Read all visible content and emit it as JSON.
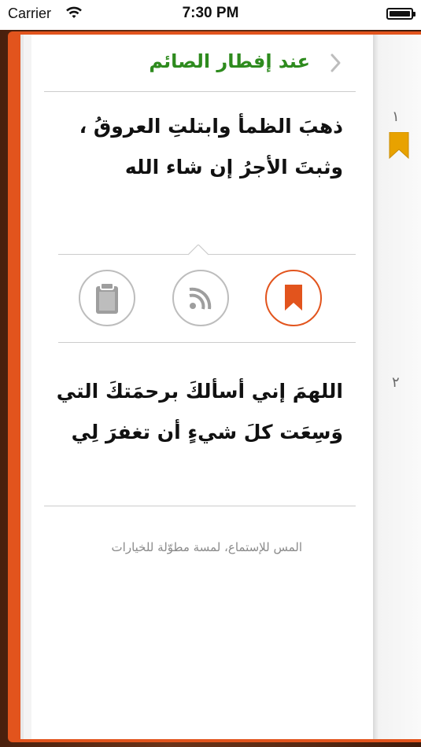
{
  "status_bar": {
    "carrier": "Carrier",
    "time": "7:30 PM"
  },
  "header": {
    "title": "عند إفطار الصائم"
  },
  "entries": [
    {
      "lines": [
        "ذهبَ الظمأ وابتلتِ العروقُ ،",
        "وثبتَ الأجرُ إن شاء الله"
      ]
    },
    {
      "lines": [
        "اللهمَ إني أسألكَ برحمَتكَ التي",
        "وَسِعَت كلَ شيءٍ أن تغفرَ لِي"
      ]
    }
  ],
  "toolbar": {
    "copy_icon": "clipboard-icon",
    "share_icon": "feed-icon",
    "bookmark_icon": "bookmark-icon",
    "active_color": "#e2541d"
  },
  "hint": "المس للإستماع، لمسة مطوّلة للخيارات",
  "side_numbers": [
    "١",
    "٢"
  ],
  "colors": {
    "accent": "#e2541d",
    "title_green": "#2e8b1e",
    "ribbon": "#e8a200"
  }
}
